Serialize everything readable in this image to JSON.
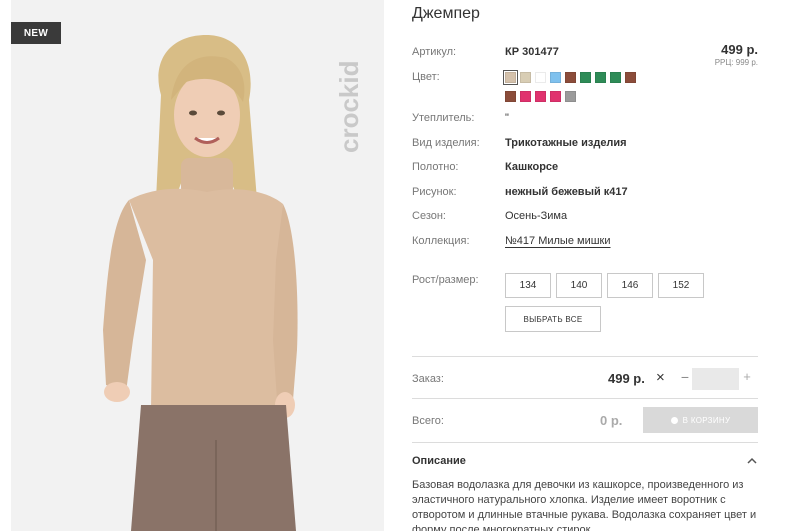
{
  "product": {
    "badge": "NEW",
    "brand": "crockid",
    "title": "Джемпер"
  },
  "details": {
    "article_label": "Артикул:",
    "article_value": "КР 301477",
    "price": "499 р.",
    "rrc": "РРЦ: 999 р.",
    "color_label": "Цвет:",
    "insulation_label": "Утеплитель:",
    "insulation_value": "\"",
    "type_label": "Вид изделия:",
    "type_value": "Трикотажные изделия",
    "fabric_label": "Полотно:",
    "fabric_value": "Кашкорсе",
    "pattern_label": "Рисунок:",
    "pattern_value": "нежный бежевый к417",
    "season_label": "Сезон:",
    "season_value": "Осень-Зима",
    "collection_label": "Коллекция:",
    "collection_value": "№417 Милые мишки"
  },
  "swatches": [
    {
      "color": "#d4c1ab",
      "selected": true
    },
    {
      "color": "#d8cdb4"
    },
    {
      "color": "#ffffff"
    },
    {
      "color": "#7fc1ee"
    },
    {
      "color": "#8b4c3a"
    },
    {
      "color": "#2e8b57"
    },
    {
      "color": "#2e8b57"
    },
    {
      "color": "#2e8b57"
    },
    {
      "color": "#8b4c3a"
    },
    {
      "color": "#8b4c3a"
    },
    {
      "color": "#e0326e"
    },
    {
      "color": "#e0326e"
    },
    {
      "color": "#e0326e"
    },
    {
      "color": "#9b9b9b"
    }
  ],
  "sizes": {
    "label": "Рост/размер:",
    "options": [
      "134",
      "140",
      "146",
      "152"
    ],
    "select_all": "ВЫБРАТЬ ВСЕ"
  },
  "order": {
    "label": "Заказ:",
    "price": "499 р.",
    "remove": "×",
    "minus": "−",
    "plus": "+",
    "quantity": ""
  },
  "total": {
    "label": "Всего:",
    "value": "0 р.",
    "cart_button": "В КОРЗИНУ"
  },
  "description": {
    "title": "Описание",
    "text": "Базовая водолазка для девочки из кашкорсе, произведенного из эластичного натурального хлопка. Изделие имеет воротник с отворотом и длинные втачные рукава. Водолазка сохраняет цвет и форму после многократных стирок."
  }
}
